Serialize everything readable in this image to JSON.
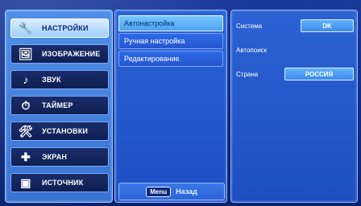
{
  "left_menu": {
    "items": [
      {
        "label": "НАСТРОЙКИ",
        "icon": "settings-wrench-icon",
        "active": true
      },
      {
        "label": "ИЗОБРАЖЕНИЕ",
        "icon": "picture-icon",
        "active": false
      },
      {
        "label": "ЗВУК",
        "icon": "sound-note-icon",
        "active": false
      },
      {
        "label": "ТАЙМЕР",
        "icon": "timer-clock-icon",
        "active": false
      },
      {
        "label": "УСТАНОВКИ",
        "icon": "setup-tools-icon",
        "active": false
      },
      {
        "label": "ЭКРАН",
        "icon": "screen-cross-icon",
        "active": false
      },
      {
        "label": "ИСТОЧНИК",
        "icon": "input-source-icon",
        "active": false
      }
    ]
  },
  "sub_menu": {
    "items": [
      {
        "label": "Автонастройка",
        "active": true
      },
      {
        "label": "Ручная настройка",
        "active": false
      },
      {
        "label": "Редактирование",
        "active": false
      }
    ],
    "hint": {
      "key": "Menu",
      "label": "Назад"
    }
  },
  "info_panel": {
    "system": {
      "label": "Система",
      "value": "DK"
    },
    "autosearch": {
      "label": "Автопоиск"
    },
    "country": {
      "label": "Страна",
      "value": "РОССИЯ"
    }
  }
}
